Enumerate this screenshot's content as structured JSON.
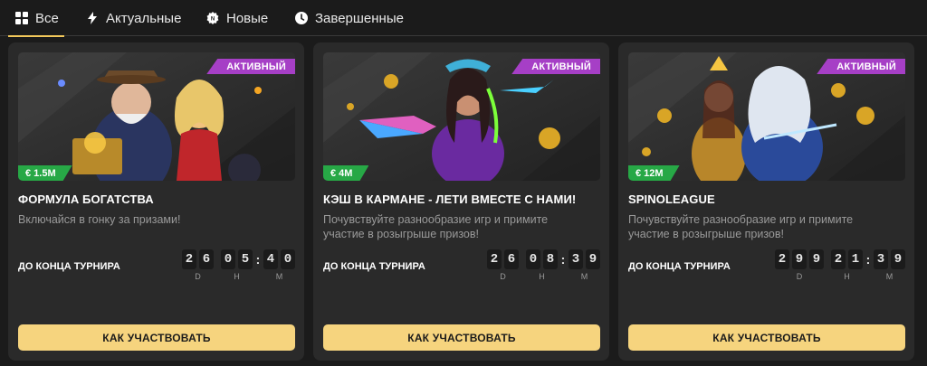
{
  "tabs": [
    {
      "label": "Все",
      "icon": "grid-icon",
      "active": true
    },
    {
      "label": "Актуальные",
      "icon": "lightning-icon",
      "active": false
    },
    {
      "label": "Новые",
      "icon": "gear-badge-icon",
      "active": false
    },
    {
      "label": "Завершенные",
      "icon": "clock-icon",
      "active": false
    }
  ],
  "colors": {
    "accent": "#f2c85b",
    "status": "#a63fc6",
    "prize": "#27a846",
    "cta": "#f6d47e"
  },
  "cards": [
    {
      "status": "АКТИВНЫЙ",
      "prize": "€ 1.5M",
      "title": "ФОРМУЛА БОГАТСТВА",
      "description": "Включайся в гонку за призами!",
      "timer_label": "ДО КОНЦА ТУРНИРА",
      "timer": {
        "d": [
          "2",
          "6"
        ],
        "h": [
          "0",
          "5"
        ],
        "m": [
          "4",
          "0"
        ]
      },
      "units": {
        "d": "D",
        "h": "H",
        "m": "M"
      },
      "cta": "КАК УЧАСТВОВАТЬ"
    },
    {
      "status": "АКТИВНЫЙ",
      "prize": "€ 4M",
      "title": "КЭШ В КАРМАНЕ - ЛЕТИ ВМЕСТЕ С НАМИ!",
      "description": "Почувствуйте разнообразие игр и примите участие в розыгрыше призов!",
      "timer_label": "ДО КОНЦА ТУРНИРА",
      "timer": {
        "d": [
          "2",
          "6"
        ],
        "h": [
          "0",
          "8"
        ],
        "m": [
          "3",
          "9"
        ]
      },
      "units": {
        "d": "D",
        "h": "H",
        "m": "M"
      },
      "cta": "КАК УЧАСТВОВАТЬ"
    },
    {
      "status": "АКТИВНЫЙ",
      "prize": "€ 12M",
      "title": "SPINOLEAGUE",
      "description": "Почувствуйте разнообразие игр и примите участие в розыгрыше призов!",
      "timer_label": "ДО КОНЦА ТУРНИРА",
      "timer": {
        "d": [
          "2",
          "9",
          "9"
        ],
        "h": [
          "2",
          "1"
        ],
        "m": [
          "3",
          "9"
        ]
      },
      "units": {
        "d": "D",
        "h": "H",
        "m": "M"
      },
      "cta": "КАК УЧАСТВОВАТЬ"
    }
  ]
}
